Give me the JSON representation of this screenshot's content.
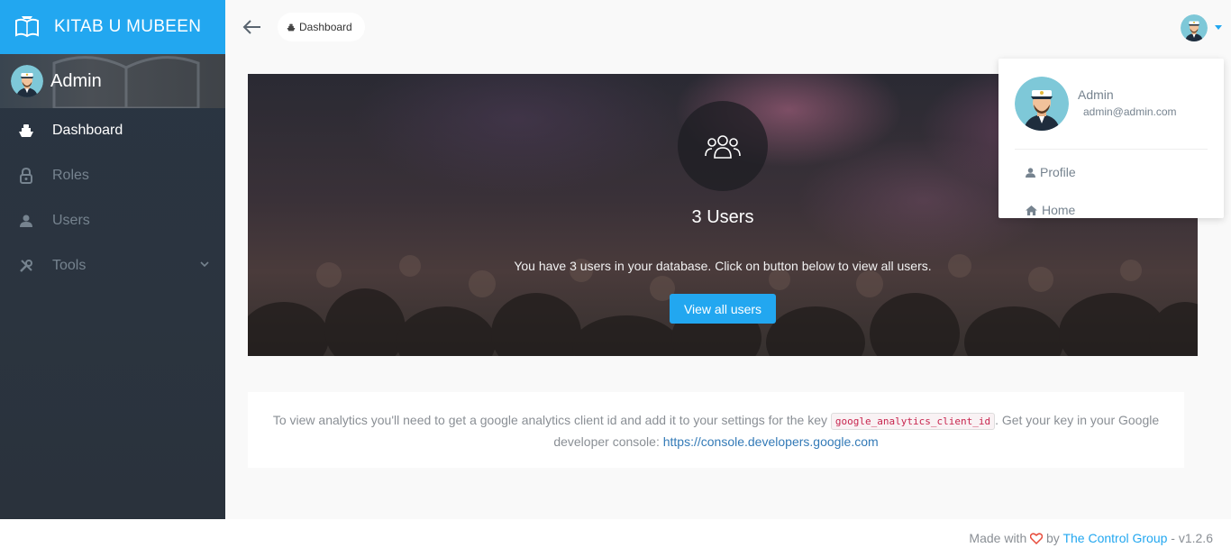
{
  "brand": {
    "title": "KITAB U MUBEEN",
    "logo_icon": "book-logo-icon",
    "accent": "#22a7f0"
  },
  "sidebar": {
    "user_name": "Admin",
    "items": [
      {
        "label": "Dashboard",
        "icon": "boat-icon",
        "active": true
      },
      {
        "label": "Roles",
        "icon": "lock-icon",
        "active": false
      },
      {
        "label": "Users",
        "icon": "person-icon",
        "active": false
      },
      {
        "label": "Tools",
        "icon": "tools-icon",
        "active": false,
        "has_children": true
      }
    ]
  },
  "header": {
    "breadcrumb": "Dashboard"
  },
  "hero": {
    "count_label": "3 Users",
    "message": "You have 3 users in your database. Click on button below to view all users.",
    "button_label": "View all users"
  },
  "analytics": {
    "text_before": "To view analytics you'll need to get a google analytics client id and add it to your settings for the key ",
    "key": "google_analytics_client_id",
    "text_after": ". Get your key in your Google developer console: ",
    "link": "https://console.developers.google.com"
  },
  "footer": {
    "made_with": "Made with",
    "by": "by",
    "company": "The Control Group",
    "version": "- v1.2.6"
  },
  "user_menu": {
    "name": "Admin",
    "email": "admin@admin.com",
    "items": [
      {
        "label": "Profile",
        "icon": "person-icon"
      },
      {
        "label": "Home",
        "icon": "home-icon"
      }
    ]
  }
}
